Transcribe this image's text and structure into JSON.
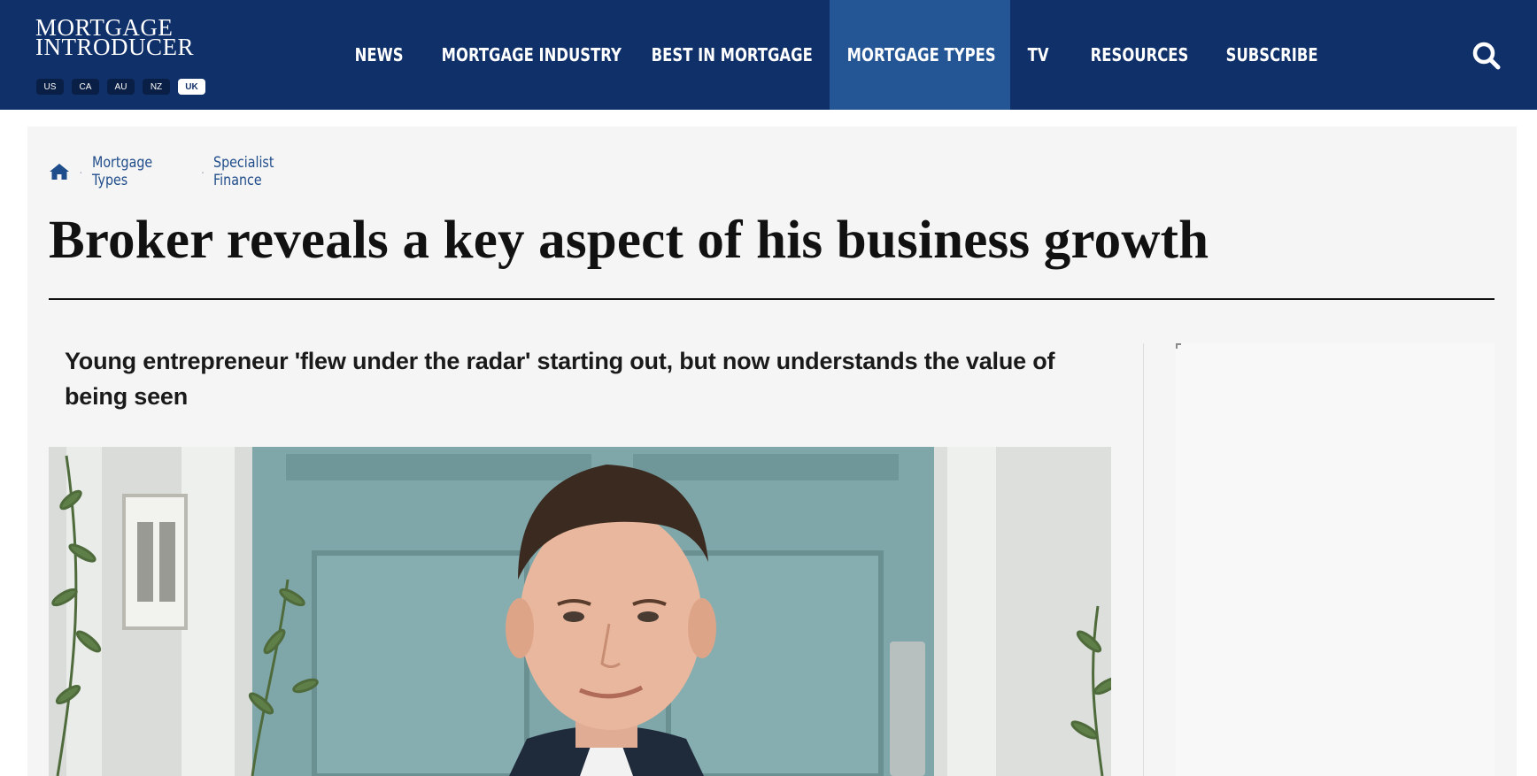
{
  "header": {
    "logo_line1": "MORTGAGE",
    "logo_line2": "INTRODUCER",
    "regions": [
      {
        "label": "US",
        "active": false
      },
      {
        "label": "CA",
        "active": false
      },
      {
        "label": "AU",
        "active": false
      },
      {
        "label": "NZ",
        "active": false
      },
      {
        "label": "UK",
        "active": true
      }
    ],
    "nav": [
      {
        "label": "NEWS",
        "active": false
      },
      {
        "label": "MORTGAGE INDUSTRY",
        "active": false
      },
      {
        "label": "BEST IN MORTGAGE",
        "active": false
      },
      {
        "label": "MORTGAGE TYPES",
        "active": true
      },
      {
        "label": "TV",
        "active": false
      },
      {
        "label": "RESOURCES",
        "active": false
      },
      {
        "label": "SUBSCRIBE",
        "active": false
      }
    ],
    "search_icon": "search-icon"
  },
  "breadcrumb": {
    "home_icon": "home-icon",
    "items": [
      "Mortgage Types",
      "Specialist Finance"
    ]
  },
  "article": {
    "headline": "Broker reveals a key aspect of his business growth",
    "standfirst": "Young entrepreneur 'flew under the radar' starting out, but now understands the value of being seen"
  },
  "colors": {
    "header_bg": "#10306a",
    "nav_active_bg": "#245595",
    "link": "#1f4c8a",
    "panel_bg": "#f5f5f5"
  }
}
